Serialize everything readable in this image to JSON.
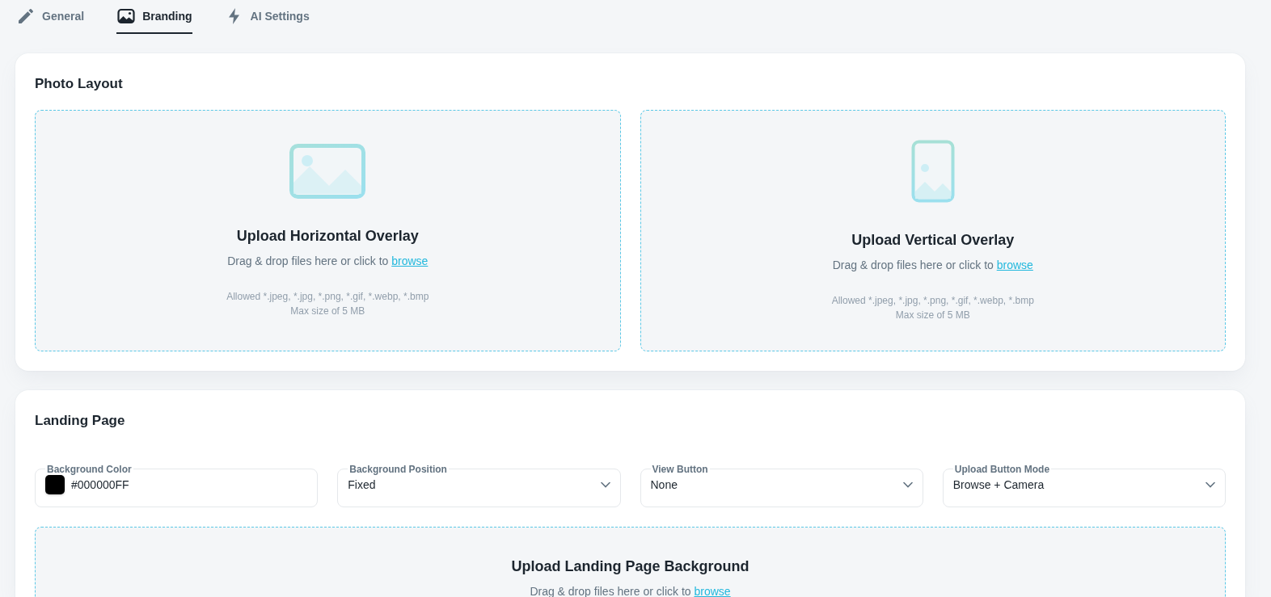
{
  "tabs": [
    {
      "label": "General",
      "selected": false
    },
    {
      "label": "Branding",
      "selected": true
    },
    {
      "label": "AI Settings",
      "selected": false
    }
  ],
  "photo_layout": {
    "title": "Photo Layout",
    "dropzones": [
      {
        "kind": "horizontal",
        "title": "Upload Horizontal Overlay",
        "prompt": "Drag & drop files here or click to",
        "link": "browse",
        "allowed": "Allowed *.jpeg, *.jpg, *.png, *.gif, *.webp, *.bmp",
        "max_size": "Max size of 5 MB"
      },
      {
        "kind": "vertical",
        "title": "Upload Vertical Overlay",
        "prompt": "Drag & drop files here or click to",
        "link": "browse",
        "allowed": "Allowed *.jpeg, *.jpg, *.png, *.gif, *.webp, *.bmp",
        "max_size": "Max size of 5 MB"
      }
    ]
  },
  "landing_page": {
    "title": "Landing Page",
    "fields": [
      {
        "kind": "color",
        "label": "Background Color",
        "value": "#000000FF",
        "color": "#000000"
      },
      {
        "kind": "select",
        "label": "Background Position",
        "value": "Fixed"
      },
      {
        "kind": "select",
        "label": "View Button",
        "value": "None"
      },
      {
        "kind": "select",
        "label": "Upload Button Mode",
        "value": "Browse + Camera"
      }
    ],
    "dropzone": {
      "title": "Upload Landing Page Background",
      "prompt": "Drag & drop files here or click to",
      "link": "browse"
    }
  }
}
